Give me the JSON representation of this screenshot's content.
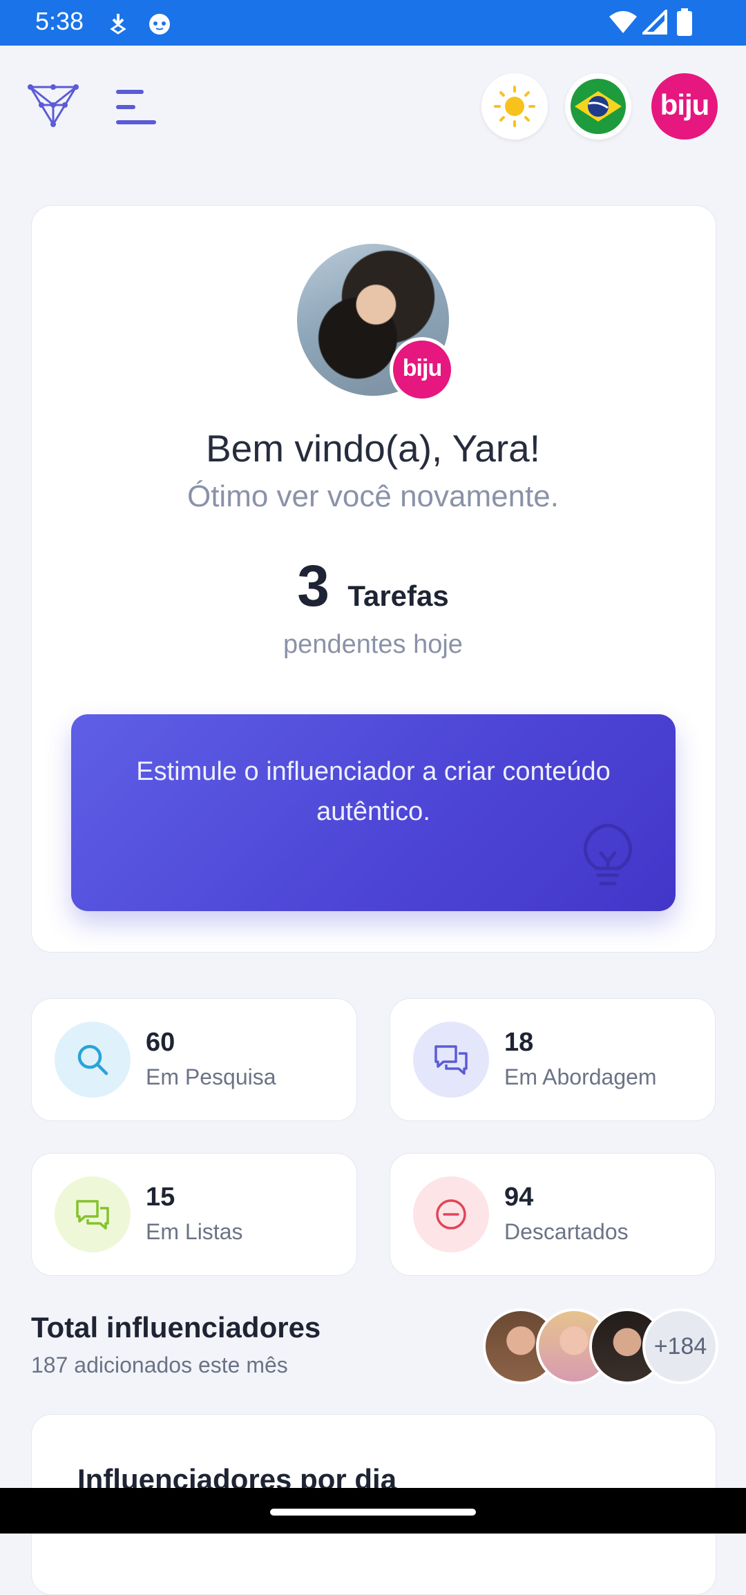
{
  "status_bar": {
    "time": "5:38",
    "icons": [
      "download-icon",
      "cat-notification-icon",
      "wifi-icon",
      "signal-icon",
      "battery-icon"
    ]
  },
  "header": {
    "logo_icon": "network-logo-icon",
    "menu_icon": "hamburger-menu-icon",
    "theme_icon": "sun-icon",
    "language_icon": "brazil-flag-icon",
    "brand_label": "biju"
  },
  "welcome": {
    "avatar_badge": "biju",
    "title": "Bem vindo(a), Yara!",
    "subtitle": "Ótimo ver você novamente.",
    "tasks_count": "3",
    "tasks_label": "Tarefas",
    "tasks_sub": "pendentes hoje",
    "tip_text": "Estimule o influenciador a criar conteúdo autêntico.",
    "tip_icon": "lightbulb-icon"
  },
  "stats": [
    {
      "value": "60",
      "label": "Em Pesquisa",
      "icon": "search-icon",
      "bg": "#dff1fb",
      "color": "#29a4d8"
    },
    {
      "value": "18",
      "label": "Em Abordagem",
      "icon": "chat-icon",
      "bg": "#e4e6fb",
      "color": "#5b5bd6"
    },
    {
      "value": "15",
      "label": "Em Listas",
      "icon": "chat-icon",
      "bg": "#eef8d8",
      "color": "#84c22a"
    },
    {
      "value": "94",
      "label": "Descartados",
      "icon": "minus-circle-icon",
      "bg": "#fde4e6",
      "color": "#e0455a"
    }
  ],
  "total": {
    "title": "Total influenciadores",
    "subtitle": "187 adicionados este mês",
    "more": "+184"
  },
  "chart_card": {
    "title": "Influenciadores por dia"
  },
  "colors": {
    "accent": "#5b5bd6",
    "brand": "#e6177f",
    "status_bar": "#1a73e8"
  }
}
